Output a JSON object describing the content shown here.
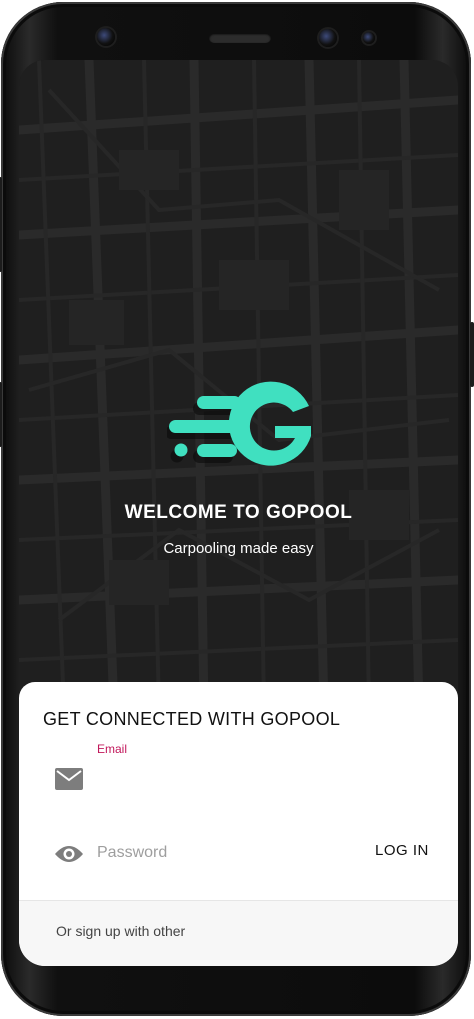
{
  "splash": {
    "title": "WELCOME TO GOPOOL",
    "tagline": "Carpooling made easy",
    "logo_letter": "G"
  },
  "login": {
    "title": "GET CONNECTED WITH GOPOOL",
    "email_label": "Email",
    "password_placeholder": "Password",
    "login_label": "LOG IN",
    "signup_text": "Or sign up with other"
  },
  "colors": {
    "brand": "#40E0C0",
    "email_label": "#C2185B",
    "background": "#1F1F1F"
  },
  "icons": [
    "mail-icon",
    "eye-icon"
  ]
}
